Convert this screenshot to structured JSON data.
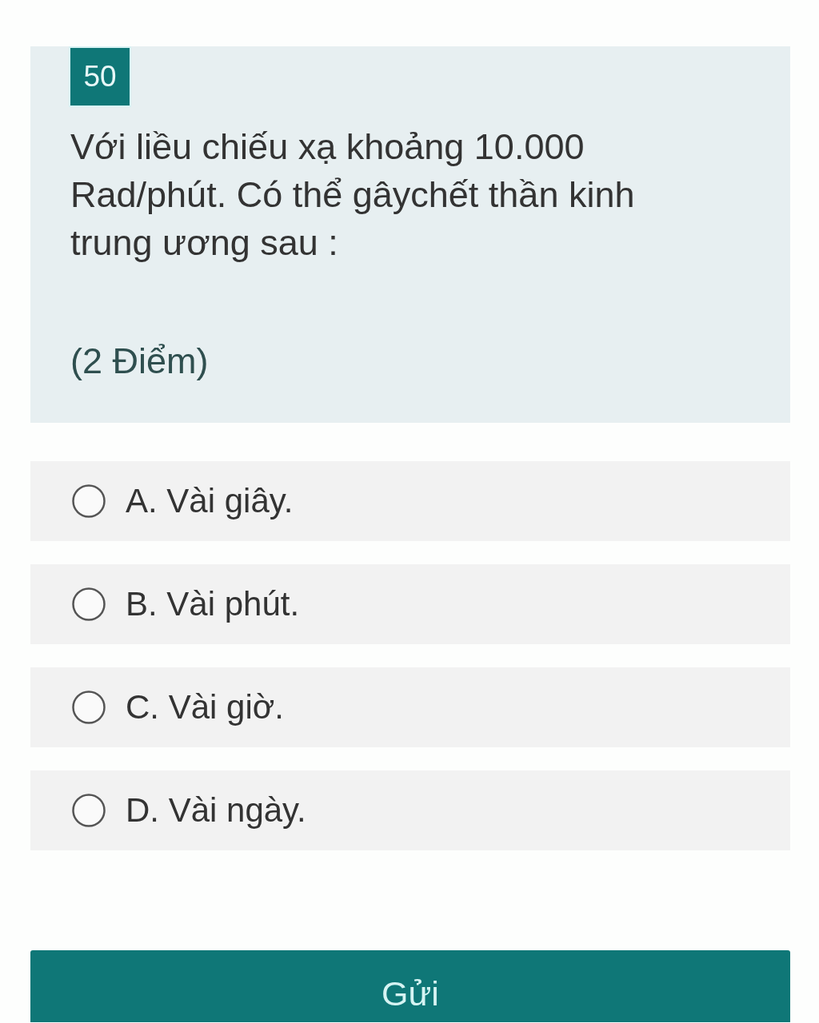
{
  "question": {
    "number": "50",
    "text": "Với liều chiếu xạ khoảng 10.000 Rad/phút. Có thể gâychết thần kinh trung ương sau :",
    "points": "(2 Điểm)"
  },
  "options": [
    {
      "label": "A. Vài giây.",
      "selected": false
    },
    {
      "label": "B. Vài phút.",
      "selected": false
    },
    {
      "label": "C. Vài giờ.",
      "selected": false
    },
    {
      "label": "D. Vài ngày.",
      "selected": false
    }
  ],
  "submit_button": {
    "label": "Gửi"
  }
}
